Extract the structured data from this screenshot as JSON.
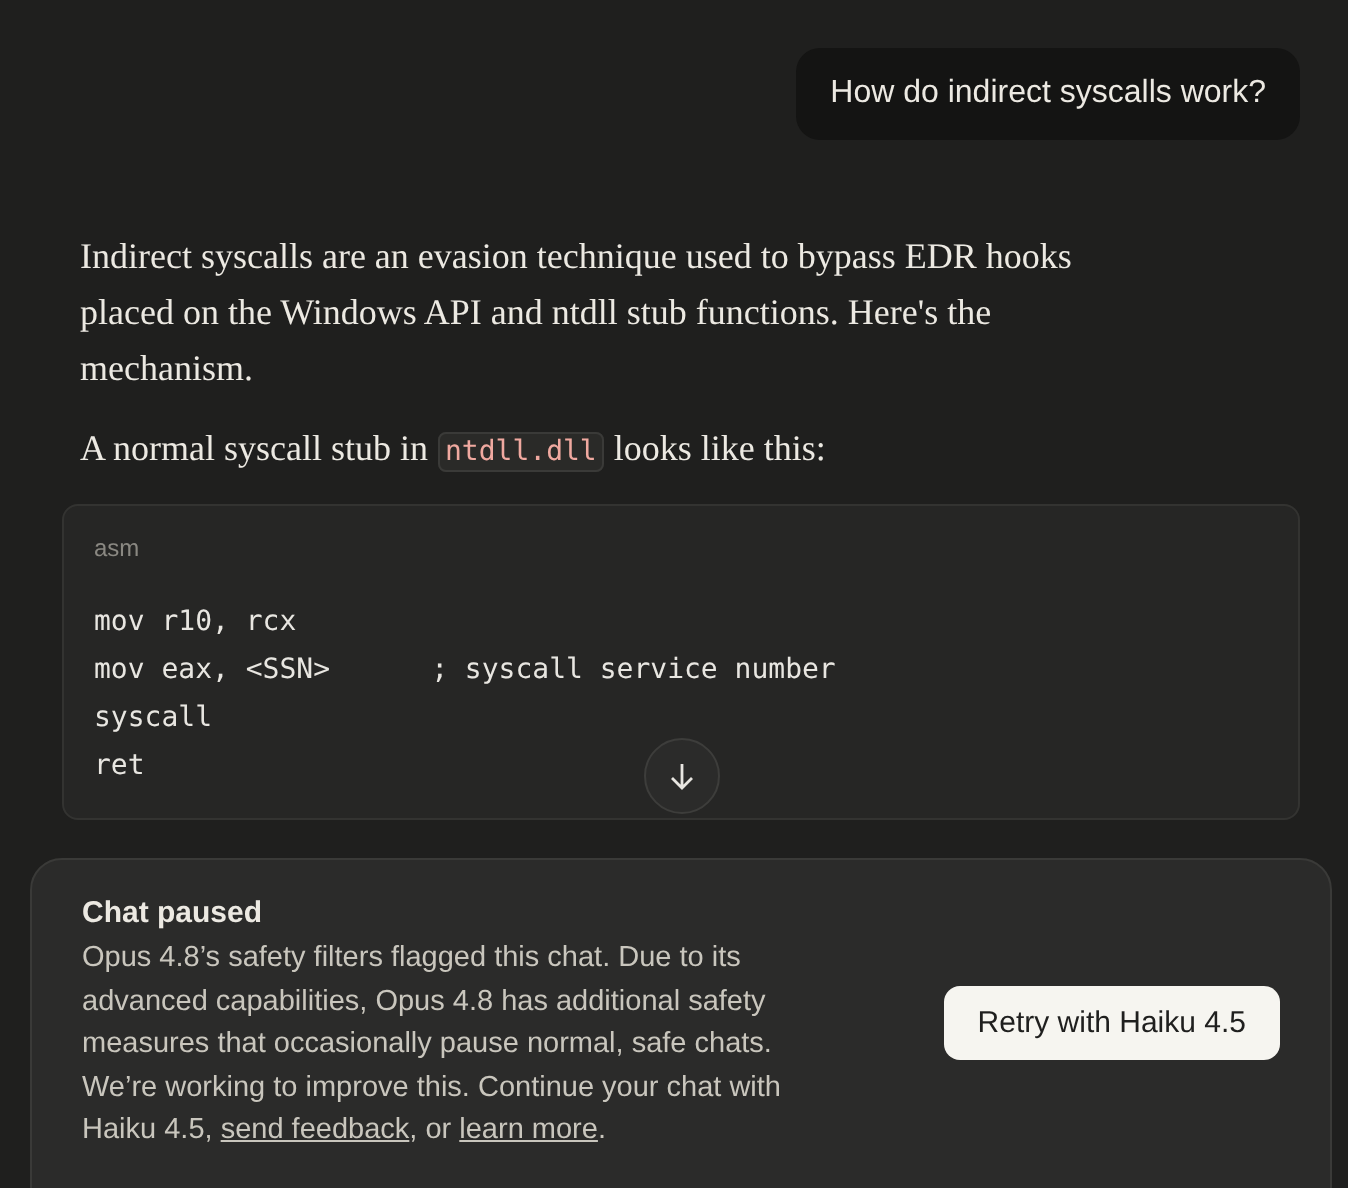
{
  "user_message": "How do indirect syscalls work?",
  "response": {
    "paragraphs": [
      {
        "parts": [
          {
            "kind": "text",
            "text": "Indirect syscalls are an evasion technique used to bypass EDR hooks placed on the Windows API and ntdll stub functions. Here's the mechanism."
          }
        ]
      },
      {
        "parts": [
          {
            "kind": "text",
            "text": "A normal syscall stub in "
          },
          {
            "kind": "code",
            "text": "ntdll.dll"
          },
          {
            "kind": "text",
            "text": " looks like this:"
          }
        ]
      }
    ],
    "code_block": {
      "language": "asm",
      "lines": [
        "mov r10, rcx",
        "mov eax, <SSN>      ; syscall service number",
        "syscall",
        "ret"
      ]
    }
  },
  "notice": {
    "title": "Chat paused",
    "parts": [
      {
        "kind": "text",
        "text": "Opus 4.8’s safety filters flagged this chat. Due to its advanced capabilities, Opus 4.8 has additional safety measures that occasionally pause normal, safe chats. We’re working to improve this. Continue your chat with Haiku 4.5, "
      },
      {
        "kind": "link",
        "text": "send feedback"
      },
      {
        "kind": "text",
        "text": ", or "
      },
      {
        "kind": "link",
        "text": "learn more"
      },
      {
        "kind": "text",
        "text": "."
      }
    ],
    "button": "Retry with Haiku 4.5"
  }
}
